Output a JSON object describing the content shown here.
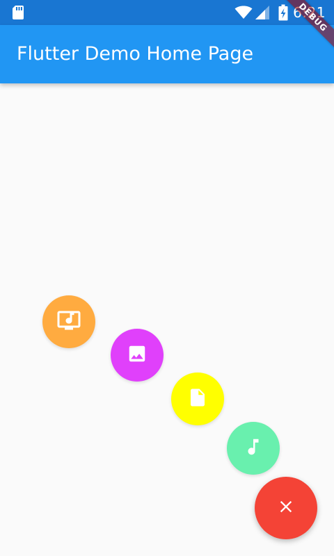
{
  "status_bar": {
    "time": "6:21",
    "icons": [
      "sd-card-icon",
      "wifi-icon",
      "cell-signal-icon",
      "battery-charging-icon"
    ],
    "background": "#1976d2"
  },
  "debug_banner": {
    "label": "DEBUG"
  },
  "app_bar": {
    "title": "Flutter Demo Home Page",
    "background": "#2196f3"
  },
  "fab_menu": {
    "items": [
      {
        "icon": "music-video-icon",
        "color": "#ffab40"
      },
      {
        "icon": "image-icon",
        "color": "#e040fb"
      },
      {
        "icon": "file-icon",
        "color": "#ffff00"
      },
      {
        "icon": "music-note-icon",
        "color": "#69f0ae"
      }
    ],
    "main_button": {
      "icon": "close-icon",
      "color": "#f44336"
    }
  }
}
